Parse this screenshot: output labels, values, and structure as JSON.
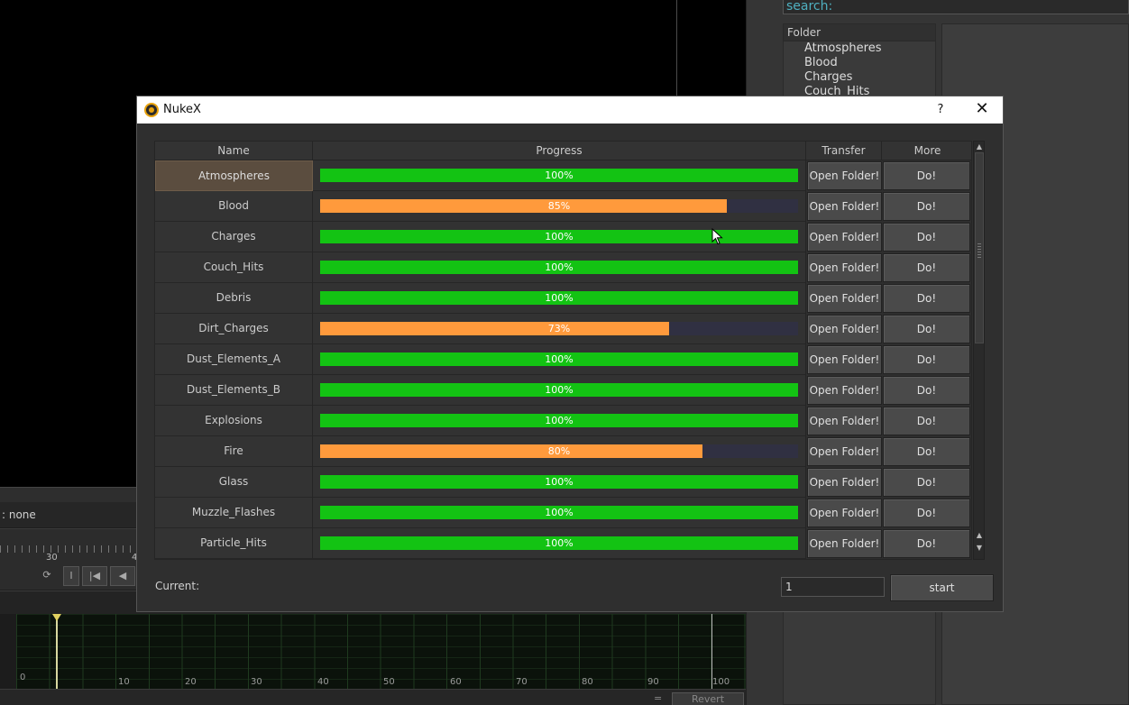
{
  "background": {
    "viewer_info": ": none",
    "ruler_label_a": "30",
    "ruler_label_b": "4",
    "curve_zero": "0",
    "curve_numbers": [
      "10",
      "20",
      "30",
      "40",
      "50",
      "60",
      "70",
      "80",
      "90",
      "100"
    ],
    "transport_buttons": [
      "⟳",
      "I",
      "|◀",
      "◀"
    ],
    "revert_label": "Revert",
    "eq_label": "="
  },
  "right_pane": {
    "search_label": "search:",
    "folder_header": "Folder",
    "folders": [
      "Atmospheres",
      "Blood",
      "Charges",
      "Couch_Hits"
    ]
  },
  "dialog": {
    "title": "NukeX",
    "help_label": "?",
    "close_label": "✕",
    "columns": {
      "name": "Name",
      "progress": "Progress",
      "transfer": "Transfer",
      "more": "More"
    },
    "colors": {
      "complete": "#13c313",
      "partial": "#ff9a3c",
      "track": "#303042"
    },
    "rows": [
      {
        "name": "Atmospheres",
        "progress": 100,
        "label": "100%",
        "open": "Open Folder!",
        "do": "Do!"
      },
      {
        "name": "Blood",
        "progress": 85,
        "label": "85%",
        "open": "Open Folder!",
        "do": "Do!"
      },
      {
        "name": "Charges",
        "progress": 100,
        "label": "100%",
        "open": "Open Folder!",
        "do": "Do!"
      },
      {
        "name": "Couch_Hits",
        "progress": 100,
        "label": "100%",
        "open": "Open Folder!",
        "do": "Do!"
      },
      {
        "name": "Debris",
        "progress": 100,
        "label": "100%",
        "open": "Open Folder!",
        "do": "Do!"
      },
      {
        "name": "Dirt_Charges",
        "progress": 73,
        "label": "73%",
        "open": "Open Folder!",
        "do": "Do!"
      },
      {
        "name": "Dust_Elements_A",
        "progress": 100,
        "label": "100%",
        "open": "Open Folder!",
        "do": "Do!"
      },
      {
        "name": "Dust_Elements_B",
        "progress": 100,
        "label": "100%",
        "open": "Open Folder!",
        "do": "Do!"
      },
      {
        "name": "Explosions",
        "progress": 100,
        "label": "100%",
        "open": "Open Folder!",
        "do": "Do!"
      },
      {
        "name": "Fire",
        "progress": 80,
        "label": "80%",
        "open": "Open Folder!",
        "do": "Do!"
      },
      {
        "name": "Glass",
        "progress": 100,
        "label": "100%",
        "open": "Open Folder!",
        "do": "Do!"
      },
      {
        "name": "Muzzle_Flashes",
        "progress": 100,
        "label": "100%",
        "open": "Open Folder!",
        "do": "Do!"
      },
      {
        "name": "Particle_Hits",
        "progress": 100,
        "label": "100%",
        "open": "Open Folder!",
        "do": "Do!"
      }
    ],
    "current_label": "Current:",
    "count_value": "1",
    "start_label": "start"
  }
}
